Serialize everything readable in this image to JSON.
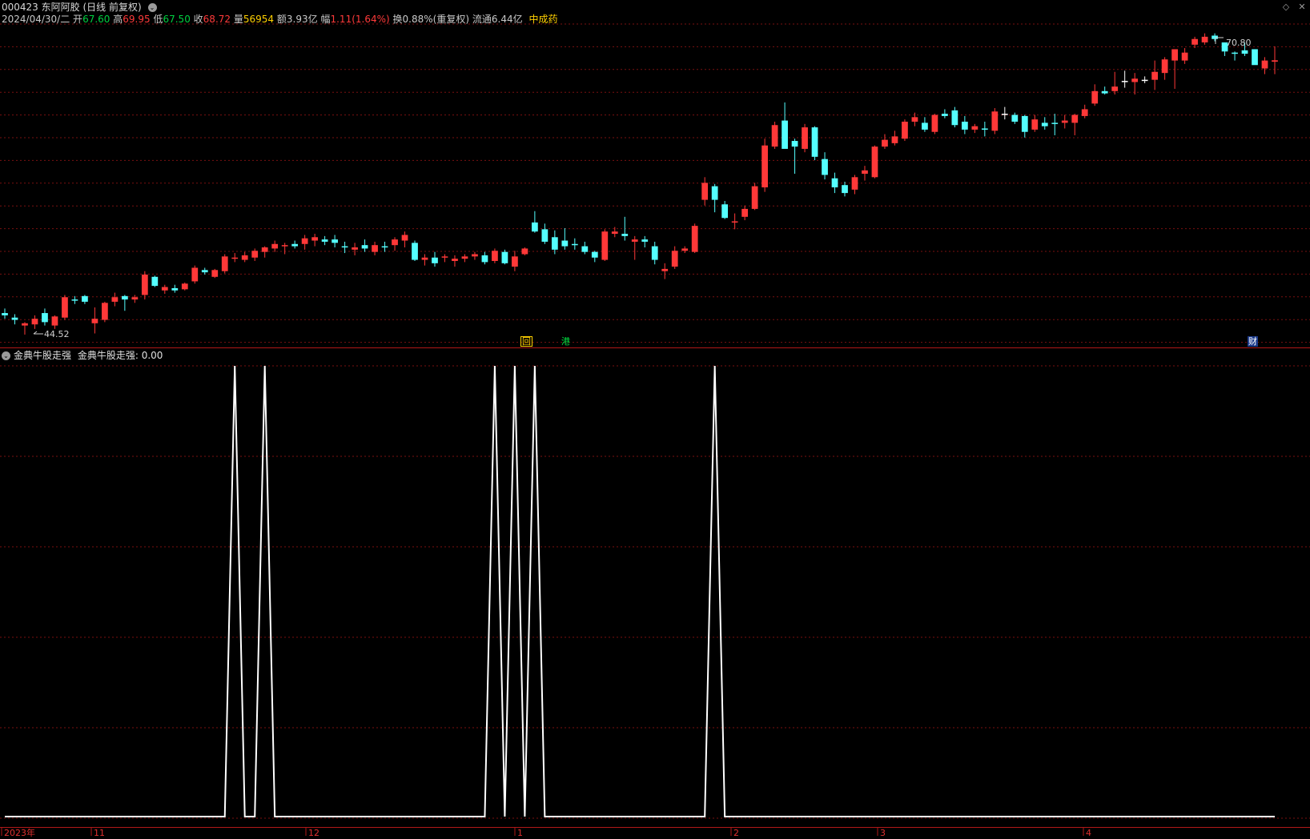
{
  "header": {
    "code": "000423",
    "name": "东阿阿胶",
    "period": "(日线 前复权)",
    "date": "2024/04/30/二",
    "open_label": "开",
    "open": "67.60",
    "high_label": "高",
    "high": "69.95",
    "low_label": "低",
    "low": "67.50",
    "close_label": "收",
    "close": "68.72",
    "vol_label": "量",
    "vol": "56954",
    "amount_label": "额",
    "amount": "3.93亿",
    "change_label": "幅",
    "change": "1.11(1.64%)",
    "turnover_label": "换",
    "turnover": "0.88%(重复权)",
    "float_label": "流通",
    "float": "6.44亿",
    "sector": "中成药"
  },
  "main_chart": {
    "max_label": "70.80",
    "min_label": "44.52",
    "markers": {
      "hui": "回",
      "gang": "港",
      "cai": "财"
    }
  },
  "indicator": {
    "name": "金典牛股走强",
    "value_text": "金典牛股走强: 0.00"
  },
  "x_axis": {
    "labels": [
      "2023年",
      "11",
      "12",
      "1",
      "2",
      "3",
      "4"
    ]
  },
  "colors": {
    "up": "#ff3838",
    "down": "#54ffff",
    "neutral": "#ffffff",
    "grid": "#7a1010",
    "frame": "#b01818",
    "sector": "#ffd000",
    "green": "#00d040",
    "red": "#ff3a3a"
  },
  "chart_data": [
    {
      "type": "candlestick",
      "title": "000423 东阿阿胶 (日线 前复权)",
      "ylim": [
        44.0,
        71.5
      ],
      "last_bar": {
        "date": "2024/04/30",
        "open": 67.6,
        "high": 69.95,
        "low": 67.5,
        "close": 68.72
      },
      "annotations": {
        "max": 70.8,
        "min": 44.52
      },
      "ohlc": [
        [
          46.4,
          46.8,
          45.9,
          46.2
        ],
        [
          46.0,
          46.3,
          45.4,
          45.8
        ],
        [
          45.3,
          45.6,
          44.5,
          45.5
        ],
        [
          45.4,
          46.2,
          45.0,
          45.9
        ],
        [
          46.4,
          46.8,
          45.3,
          45.6
        ],
        [
          45.3,
          46.2,
          45.0,
          46.1
        ],
        [
          46.0,
          48.0,
          45.8,
          47.8
        ],
        [
          47.6,
          47.9,
          47.2,
          47.5
        ],
        [
          47.9,
          48.0,
          47.2,
          47.4
        ],
        [
          45.5,
          46.9,
          44.6,
          45.9
        ],
        [
          45.8,
          47.4,
          45.6,
          47.3
        ],
        [
          47.4,
          48.2,
          47.0,
          47.8
        ],
        [
          47.9,
          48.0,
          46.6,
          47.6
        ],
        [
          47.6,
          48.0,
          47.3,
          47.8
        ],
        [
          48.0,
          50.1,
          47.6,
          49.8
        ],
        [
          49.6,
          49.7,
          48.7,
          48.8
        ],
        [
          48.4,
          48.9,
          48.1,
          48.7
        ],
        [
          48.6,
          48.9,
          48.2,
          48.4
        ],
        [
          48.5,
          49.1,
          48.4,
          49.0
        ],
        [
          49.2,
          50.6,
          49.0,
          50.4
        ],
        [
          50.2,
          50.4,
          49.8,
          50.0
        ],
        [
          49.6,
          50.3,
          49.5,
          50.2
        ],
        [
          50.1,
          51.6,
          49.9,
          51.4
        ],
        [
          51.2,
          51.7,
          50.9,
          51.3
        ],
        [
          51.1,
          51.8,
          50.9,
          51.5
        ],
        [
          51.3,
          52.1,
          51.0,
          51.9
        ],
        [
          51.8,
          52.3,
          51.3,
          52.2
        ],
        [
          52.1,
          52.8,
          51.8,
          52.5
        ],
        [
          52.3,
          52.6,
          51.6,
          52.4
        ],
        [
          52.5,
          52.8,
          52.1,
          52.3
        ],
        [
          52.5,
          53.3,
          52.0,
          53.0
        ],
        [
          52.8,
          53.4,
          52.3,
          53.1
        ],
        [
          52.9,
          53.2,
          52.4,
          52.7
        ],
        [
          52.9,
          53.3,
          52.2,
          52.6
        ],
        [
          52.3,
          52.7,
          51.7,
          52.2
        ],
        [
          52.0,
          52.6,
          51.5,
          52.2
        ],
        [
          52.4,
          52.9,
          51.8,
          52.1
        ],
        [
          51.8,
          52.7,
          51.5,
          52.4
        ],
        [
          52.3,
          52.7,
          51.8,
          52.2
        ],
        [
          52.4,
          53.1,
          51.9,
          52.9
        ],
        [
          52.8,
          53.6,
          52.2,
          53.3
        ],
        [
          52.6,
          52.8,
          51.0,
          51.1
        ],
        [
          51.1,
          51.6,
          50.6,
          51.3
        ],
        [
          51.3,
          51.8,
          50.5,
          50.8
        ],
        [
          51.3,
          51.6,
          50.9,
          51.4
        ],
        [
          51.0,
          51.5,
          50.5,
          51.2
        ],
        [
          51.2,
          51.6,
          50.9,
          51.4
        ],
        [
          51.4,
          51.8,
          51.1,
          51.6
        ],
        [
          51.5,
          51.8,
          50.7,
          50.9
        ],
        [
          51.0,
          52.1,
          50.8,
          51.9
        ],
        [
          51.8,
          52.0,
          50.7,
          50.8
        ],
        [
          50.5,
          51.9,
          50.1,
          51.4
        ],
        [
          51.6,
          52.2,
          51.5,
          52.1
        ],
        [
          54.4,
          55.4,
          53.5,
          53.6
        ],
        [
          53.8,
          54.3,
          52.5,
          52.7
        ],
        [
          53.1,
          53.7,
          51.6,
          52.0
        ],
        [
          52.8,
          53.9,
          52.0,
          52.3
        ],
        [
          52.5,
          53.0,
          52.0,
          52.4
        ],
        [
          52.3,
          52.7,
          51.6,
          51.8
        ],
        [
          51.8,
          51.9,
          50.9,
          51.3
        ],
        [
          51.1,
          53.8,
          51.0,
          53.6
        ],
        [
          53.4,
          54.0,
          53.1,
          53.6
        ],
        [
          53.4,
          54.9,
          52.8,
          53.2
        ],
        [
          52.7,
          53.2,
          51.1,
          52.9
        ],
        [
          52.9,
          53.2,
          52.2,
          52.7
        ],
        [
          52.3,
          52.7,
          50.7,
          51.1
        ],
        [
          50.1,
          50.8,
          49.4,
          50.3
        ],
        [
          50.5,
          52.3,
          50.3,
          51.9
        ],
        [
          51.9,
          52.3,
          51.7,
          52.1
        ],
        [
          51.8,
          54.3,
          51.7,
          54.1
        ],
        [
          56.4,
          58.4,
          55.9,
          57.9
        ],
        [
          57.6,
          57.8,
          55.3,
          56.4
        ],
        [
          56.0,
          56.3,
          54.7,
          54.8
        ],
        [
          54.4,
          55.2,
          53.8,
          54.5
        ],
        [
          54.9,
          55.9,
          54.6,
          55.6
        ],
        [
          55.6,
          57.9,
          55.5,
          57.6
        ],
        [
          57.5,
          61.8,
          57.1,
          61.2
        ],
        [
          61.1,
          63.3,
          60.9,
          63.0
        ],
        [
          63.4,
          65.0,
          62.7,
          60.9
        ],
        [
          61.6,
          61.8,
          58.7,
          61.1
        ],
        [
          60.9,
          63.1,
          60.6,
          62.8
        ],
        [
          62.8,
          62.9,
          59.9,
          60.2
        ],
        [
          60.0,
          60.6,
          58.2,
          58.6
        ],
        [
          58.3,
          58.8,
          57.0,
          57.5
        ],
        [
          57.7,
          58.0,
          56.7,
          57.0
        ],
        [
          57.3,
          58.6,
          56.9,
          58.4
        ],
        [
          58.7,
          59.4,
          58.1,
          59.0
        ],
        [
          58.4,
          61.2,
          58.3,
          61.1
        ],
        [
          61.1,
          62.2,
          60.9,
          61.7
        ],
        [
          61.4,
          62.5,
          61.2,
          62.0
        ],
        [
          61.8,
          63.5,
          61.6,
          63.3
        ],
        [
          63.3,
          64.1,
          62.9,
          63.7
        ],
        [
          63.2,
          63.7,
          62.4,
          62.6
        ],
        [
          62.4,
          64.0,
          62.2,
          63.9
        ],
        [
          64.0,
          64.4,
          63.6,
          63.8
        ],
        [
          64.3,
          64.6,
          62.8,
          63.0
        ],
        [
          63.3,
          63.8,
          62.2,
          62.6
        ],
        [
          62.6,
          63.1,
          62.3,
          62.9
        ],
        [
          62.7,
          63.3,
          62.0,
          62.6
        ],
        [
          62.5,
          64.5,
          62.2,
          64.2
        ],
        [
          64.0,
          64.6,
          63.5,
          64.0
        ],
        [
          63.9,
          64.1,
          63.1,
          63.3
        ],
        [
          63.8,
          63.9,
          61.9,
          62.4
        ],
        [
          62.6,
          63.9,
          62.4,
          63.5
        ],
        [
          63.2,
          63.7,
          62.6,
          62.9
        ],
        [
          63.2,
          64.0,
          62.1,
          63.1
        ],
        [
          63.2,
          63.9,
          62.7,
          63.4
        ],
        [
          63.2,
          64.0,
          62.1,
          63.9
        ],
        [
          63.8,
          64.8,
          63.6,
          64.4
        ],
        [
          64.9,
          66.6,
          64.7,
          66.0
        ],
        [
          66.0,
          66.4,
          65.7,
          65.8
        ],
        [
          66.0,
          67.7,
          65.7,
          66.4
        ],
        [
          66.9,
          67.8,
          66.3,
          66.9
        ],
        [
          66.8,
          67.6,
          65.7,
          67.1
        ],
        [
          67.0,
          67.3,
          66.7,
          67.0
        ],
        [
          67.0,
          68.7,
          66.1,
          67.7
        ],
        [
          67.6,
          69.0,
          67.0,
          68.8
        ],
        [
          68.7,
          68.9,
          66.2,
          69.7
        ],
        [
          68.7,
          69.8,
          68.4,
          69.4
        ],
        [
          70.1,
          70.8,
          69.8,
          70.6
        ],
        [
          70.3,
          71.1,
          70.1,
          70.8
        ],
        [
          70.9,
          71.1,
          70.4,
          70.6
        ],
        [
          70.3,
          70.3,
          69.1,
          69.5
        ],
        [
          69.4,
          69.5,
          68.7,
          69.3
        ],
        [
          69.6,
          70.3,
          69.1,
          69.3
        ],
        [
          69.7,
          69.7,
          68.4,
          68.3
        ],
        [
          68.0,
          69.0,
          67.5,
          68.7
        ],
        [
          68.6,
          69.95,
          67.5,
          68.72
        ]
      ]
    },
    {
      "type": "line",
      "title": "金典牛股走强",
      "ylim": [
        0,
        1
      ],
      "series": [
        {
          "name": "金典牛股走强",
          "spikes_at_bar": [
            23,
            26,
            49,
            51,
            53,
            71
          ],
          "last_value": 0.0
        }
      ]
    }
  ]
}
